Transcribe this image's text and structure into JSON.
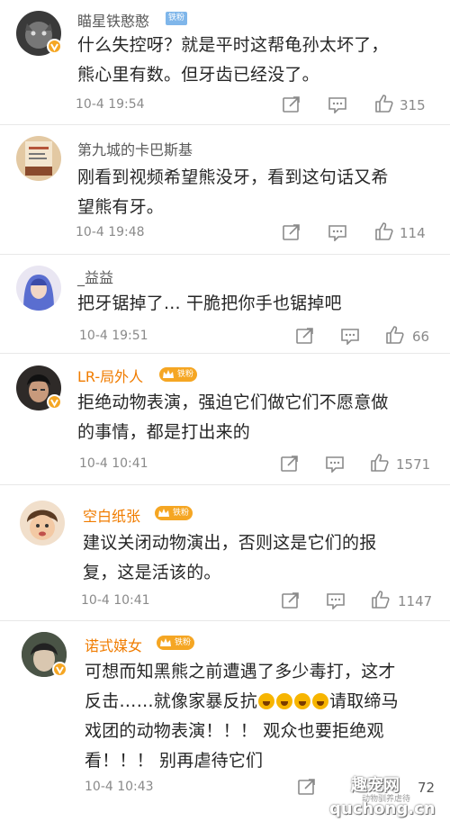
{
  "comments": [
    {
      "user": "瞄星铁憨憨",
      "badge": "铁粉",
      "text_lines": [
        "什么失控呀？就是平时这帮龟孙太坏了，",
        "熊心里有数。但牙齿已经没了。"
      ],
      "time": "10-4 19:54",
      "likes": "315",
      "avatar_color": "#3a3a3a"
    },
    {
      "user": "第九城的卡巴斯基",
      "text_lines": [
        "刚看到视频希望熊没牙，看到这句话又希",
        "望熊有牙。"
      ],
      "time": "10-4 19:48",
      "likes": "114",
      "avatar_color": "#d9b48a"
    },
    {
      "user": "_益益",
      "text_lines": [
        "把牙锯掉了... 干脆把你手也锯掉吧"
      ],
      "time": "10-4 19:51",
      "likes": "66",
      "avatar_color": "#6c7fd0"
    },
    {
      "user": "LR-局外人",
      "badge": "铁粉",
      "text_lines": [
        "拒绝动物表演，强迫它们做它们不愿意做",
        "的事情，都是打出来的"
      ],
      "time": "10-4 10:41",
      "likes": "1571",
      "avatar_color": "#2e2a28"
    },
    {
      "user": "空白纸张",
      "badge": "铁粉",
      "text_lines": [
        "建议关闭动物演出，否则这是它们的报",
        "复，这是活该的。"
      ],
      "time": "10-4 10:41",
      "likes": "1147",
      "avatar_color": "#e9c7a6"
    },
    {
      "user": "诺式媒女",
      "badge": "铁粉",
      "text_lines": [
        "可想而知黑熊之前遭遇了多少毒打，这才",
        "反击……就像家暴反抗",
        "请取缔马",
        "戏团的动物表演！！！ 观众也要拒绝观",
        "看！！！ 别再虐待它们"
      ],
      "time": "10-4 10:43",
      "likes": "72",
      "avatar_color": "#586050"
    }
  ],
  "watermark": {
    "main": "趣宠网",
    "sub": "动物驯养虐待",
    "url": "quchong.cn"
  },
  "colors": {
    "vip_name": "#f07c00",
    "plain_name": "#5a5a5a",
    "fan_badge": "#7fb6ea",
    "vip_badge": "#f5a623"
  },
  "icons": [
    "repost-icon",
    "comment-icon",
    "like-icon",
    "verified-badge-icon",
    "crown-icon",
    "emoji-icon"
  ]
}
